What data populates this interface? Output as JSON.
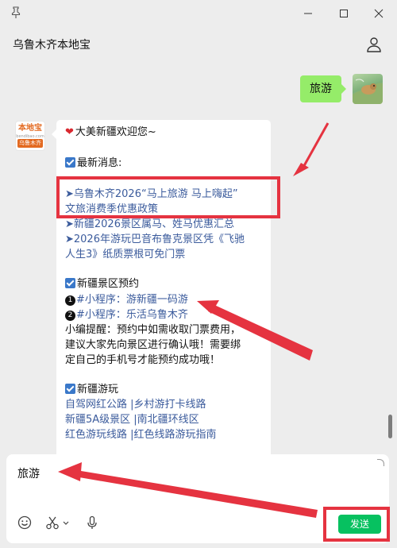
{
  "window": {
    "title": "乌鲁木齐本地宝"
  },
  "icons": {
    "pin": "pin-icon",
    "minimize": "minimize-icon",
    "maximize": "maximize-icon",
    "close": "close-icon",
    "profile": "user-icon",
    "emoji": "smile-icon",
    "scissors": "scissors-icon",
    "mic": "microphone-icon"
  },
  "chat": {
    "user_message": "旅游",
    "bot_avatar": {
      "brand": "本地宝",
      "site": "bendibao.com",
      "city": "乌鲁木齐"
    },
    "bot_message": {
      "welcome": "大美新疆欢迎您~",
      "news_header": "最新消息:",
      "news_items": [
        "➤乌鲁木齐2026“马上旅游 马上嗨起”",
        "文旅消费季优惠政策",
        "➤新疆2026景区属马、姓马优惠汇总",
        "➤2026年游玩巴音布鲁克景区凭《飞驰",
        "人生3》纸质票根可免门票"
      ],
      "booking_header": "新疆景区预约",
      "booking_num1": "1",
      "booking_item1": "#小程序：游新疆一码游",
      "booking_num2": "2",
      "booking_item2": "#小程序：乐活乌鲁木齐",
      "tip_lines": [
        "小编提醒：预约中如需收取门票费用，",
        "建议大家先向景区进行确认哦！需要绑",
        "定自己的手机号才能预约成功哦！"
      ],
      "play_header": "新疆游玩",
      "play_links": [
        "自驾网红公路 |乡村游打卡线路",
        "新疆5A级景区 |南北疆环线区",
        "红色游玩线路 |红色线路游玩指南"
      ]
    }
  },
  "input": {
    "value": "旅游",
    "send_label": "发送"
  },
  "colors": {
    "accent_green": "#07c160",
    "bubble_green": "#95ec69",
    "link": "#3b5b9c",
    "annotation": "#e53340"
  }
}
